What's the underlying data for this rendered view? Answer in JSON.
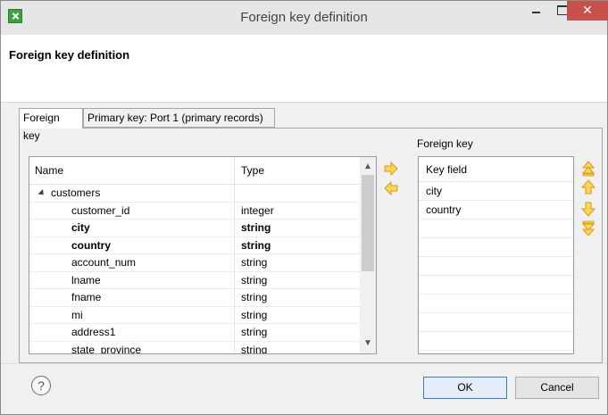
{
  "window": {
    "title": "Foreign key definition"
  },
  "header": {
    "title": "Foreign key definition"
  },
  "tabs": [
    {
      "label": "Foreign key"
    },
    {
      "label": "Primary key: Port 1 (primary records)"
    }
  ],
  "fields_table": {
    "columns": [
      "Name",
      "Type"
    ],
    "root": "customers",
    "rows": [
      {
        "name": "customer_id",
        "type": "integer",
        "bold": false
      },
      {
        "name": "city",
        "type": "string",
        "bold": true
      },
      {
        "name": "country",
        "type": "string",
        "bold": true
      },
      {
        "name": "account_num",
        "type": "string",
        "bold": false
      },
      {
        "name": "lname",
        "type": "string",
        "bold": false
      },
      {
        "name": "fname",
        "type": "string",
        "bold": false
      },
      {
        "name": "mi",
        "type": "string",
        "bold": false
      },
      {
        "name": "address1",
        "type": "string",
        "bold": false
      },
      {
        "name": "state_province",
        "type": "string",
        "bold": false
      }
    ]
  },
  "foreign_key": {
    "section_label": "Foreign key",
    "column": "Key field",
    "fields": [
      "city",
      "country"
    ]
  },
  "icons": {
    "move_right": "arrow-right-icon",
    "move_left": "arrow-left-icon",
    "move_top": "double-up-icon",
    "move_up": "arrow-up-icon",
    "move_down": "arrow-down-icon",
    "move_bottom": "double-down-icon",
    "help": "question-icon"
  },
  "footer": {
    "help_glyph": "?",
    "ok_label": "OK",
    "cancel_label": "Cancel"
  },
  "colors": {
    "accent_arrow": "#f5b221",
    "close_button": "#c7504b"
  }
}
